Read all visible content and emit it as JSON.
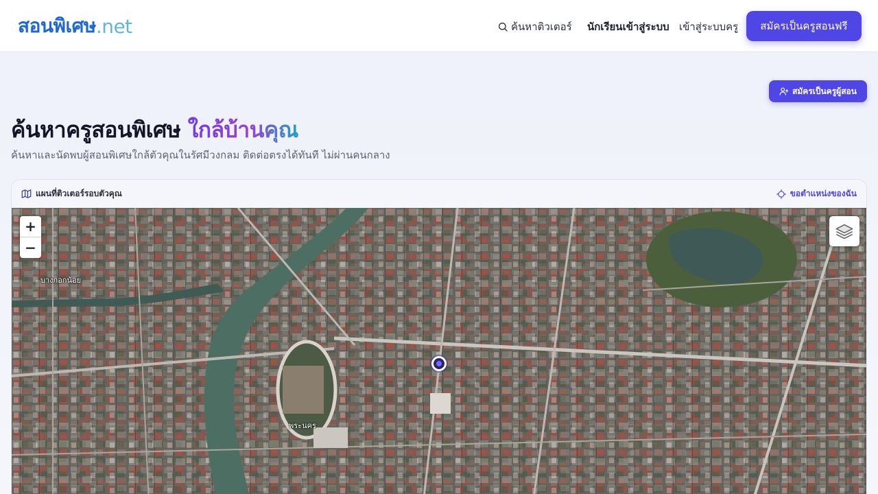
{
  "header": {
    "logo_main": "สอนพิเศษ",
    "logo_tld": ".net",
    "nav_search": "ค้นหาติวเตอร์",
    "nav_student": "นักเรียนเข้าสู่ระบบ",
    "nav_teacher_login": "เข้าสู่ระบบครู",
    "register_button": "สมัครเป็นครูสอนฟรี"
  },
  "hero": {
    "register_small_button": "สมัครเป็นครูผู้สอน",
    "title_main": "ค้นหาครูสอนพิเศษ ",
    "title_highlight": "ใกล้บ้านคุณ",
    "subtitle": "ค้นหาและนัดพบผู้สอนพิเศษใกล้ตัวคุณในรัศมีวงกลม ติดต่อตรงได้ทันที ไม่ผ่านคนกลาง"
  },
  "map": {
    "header_title": "แผนที่ติวเตอร์รอบตัวคุณ",
    "locate_me": "ขอตำแหน่งของฉัน",
    "zoom_in": "+",
    "zoom_out": "−",
    "labels": {
      "district_1": "บางกอกน้อย",
      "district_2": "พระนคร"
    },
    "icons": {
      "search": "search-icon",
      "map": "map-icon",
      "locate": "crosshair-icon",
      "layers": "layers-icon",
      "user_plus": "user-plus-icon"
    }
  },
  "colors": {
    "primary": "#4f46e5",
    "logo_blue": "#1d67d8",
    "logo_light": "#5fb4e8"
  }
}
